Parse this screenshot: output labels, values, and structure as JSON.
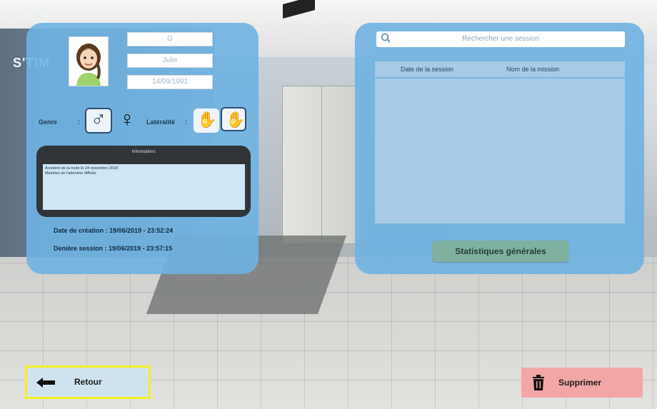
{
  "brand": {
    "name": "S'TIM"
  },
  "patient": {
    "last_name": "G",
    "first_name": "Julie",
    "birth_date": "14/09/1991"
  },
  "labels": {
    "genre": "Genre",
    "genre_colon": ":",
    "laterality": "Latéralité",
    "laterality_colon": ":",
    "info_title": "Informations",
    "creation_date_label": "Date de création :",
    "last_session_label": "Denière session :"
  },
  "laterality": {
    "left_letter": "G",
    "right_letter": "D"
  },
  "info_text_lines": [
    "Accident de la route le 24 novembre 2018",
    "Maintien de l'attention difficile"
  ],
  "dates": {
    "creation": "19/06/2019 - 23:52:24",
    "last_session": "19/06/2019 - 23:57:15"
  },
  "sessions": {
    "search_placeholder": "Rechercher une session",
    "columns": [
      "Date de la session",
      "Nom de la mission"
    ],
    "rows": []
  },
  "buttons": {
    "stats": "Statistiques générales",
    "back": "Retour",
    "delete": "Supprimer"
  },
  "colors": {
    "panel": "#6eb2e2",
    "back_highlight": "#f5ef22",
    "delete_bg": "#f3a6a6",
    "stats_bg": "#7fb0a0"
  }
}
